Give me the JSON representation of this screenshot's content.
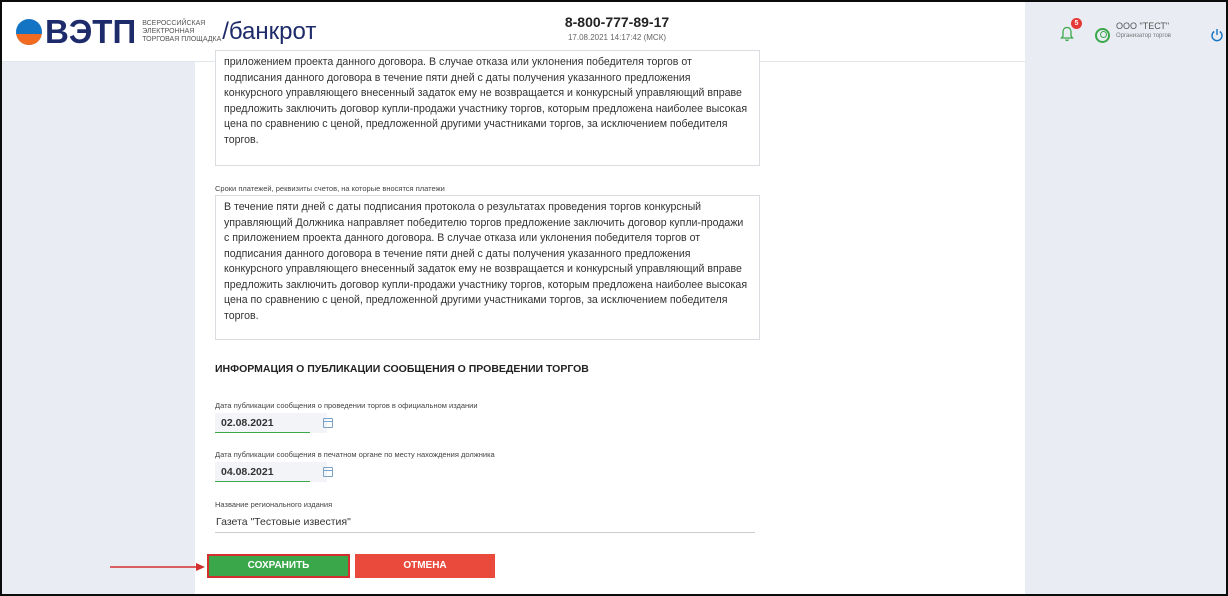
{
  "header": {
    "logo_main": "ВЭТП",
    "logo_sub_1": "ВСЕРОССИЙСКАЯ",
    "logo_sub_2": "ЭЛЕКТРОННАЯ",
    "logo_sub_3": "ТОРГОВАЯ ПЛОЩАДКА",
    "section": "/банкрот",
    "phone": "8-800-777-89-17",
    "datetime": "17.08.2021 14:17:42 (МСК)",
    "notifications_count": "5",
    "user_name": "ООО \"ТЕСТ\"",
    "user_role": "Организатор торгов"
  },
  "form": {
    "textarea_1": "приложением проекта данного договора. В случае отказа или уклонения победителя торгов от подписания данного договора в течение пяти дней с даты получения указанного предложения конкурсного управляющего внесенный задаток ему не возвращается и конкурсный управляющий вправе предложить заключить договор купли-продажи участнику торгов, которым предложена наиболее высокая цена по сравнению с ценой, предложенной другими участниками торгов, за исключением победителя торгов.",
    "payment_label": "Сроки платежей, реквизиты счетов, на которые вносятся платежи",
    "payment_text": "В течение пяти дней с даты подписания протокола о результатах проведения торгов конкурсный управляющий Должника направляет победителю торгов предложение заключить договор купли-продажи с приложением проекта данного договора. В случае отказа или уклонения победителя торгов от подписания данного договора в течение пяти дней с даты получения указанного предложения конкурсного управляющего внесенный задаток ему не возвращается и конкурсный управляющий вправе предложить заключить договор купли-продажи участнику торгов, которым предложена наиболее высокая цена по сравнению с ценой, предложенной другими участниками торгов, за исключением победителя торгов.",
    "section_title": "ИНФОРМАЦИЯ О ПУБЛИКАЦИИ СООБЩЕНИЯ О ПРОВЕДЕНИИ ТОРГОВ",
    "official_date_label": "Дата публикации сообщения о проведении торгов в официальном издании",
    "official_date": "02.08.2021",
    "print_date_label": "Дата публикации сообщения в печатном органе по месту нахождения должника",
    "print_date": "04.08.2021",
    "regional_label": "Название регионального издания",
    "regional_value": "Газета \"Тестовые известия\"",
    "save_label": "СОХРАНИТЬ",
    "cancel_label": "ОТМЕНА"
  },
  "colors": {
    "save": "#3aa84a",
    "cancel": "#ea4a3b",
    "highlight": "#d32f2f",
    "brand": "#1e2b6b"
  }
}
